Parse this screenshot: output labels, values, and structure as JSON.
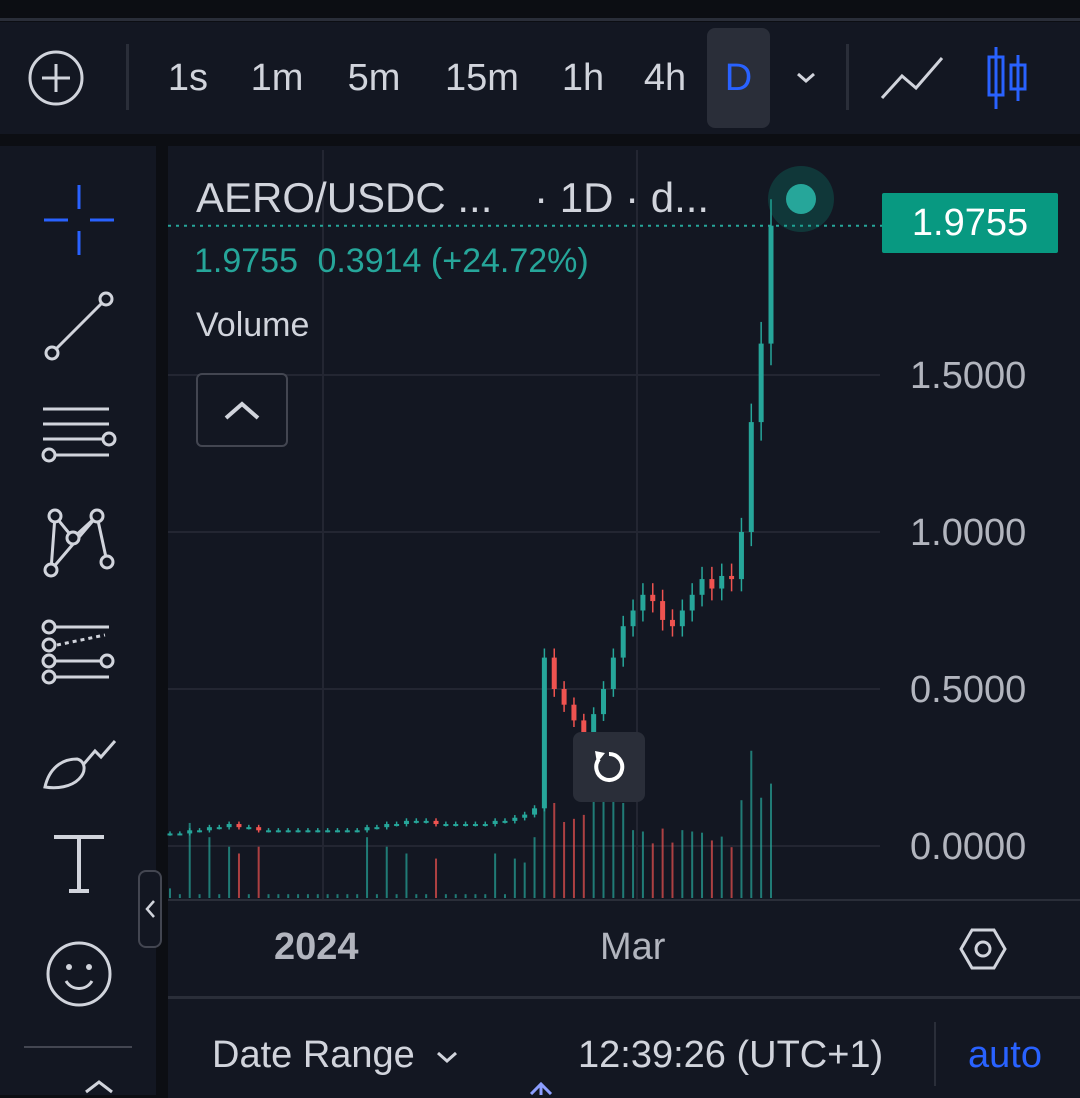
{
  "toolbar": {
    "intervals": [
      "1s",
      "1m",
      "5m",
      "15m",
      "1h",
      "4h",
      "D"
    ],
    "active_interval": "D"
  },
  "legend": {
    "title": "AERO/USDC ...",
    "timeframe": "· 1D · d...",
    "last": "1.9755",
    "change": "0.3914 (+24.72%)",
    "volume_label": "Volume"
  },
  "price_badge": "1.9755",
  "footer": {
    "date_range": "Date Range",
    "clock": "12:39:26 (UTC+1)",
    "auto": "auto"
  },
  "colors": {
    "up": "#26a69a",
    "down": "#ef5350",
    "badge": "#089981",
    "active_interval": "#2962ff"
  },
  "chart_data": {
    "type": "candlestick",
    "symbol": "AERO/USDC",
    "interval": "1D",
    "y_ticks": [
      "0.0000",
      "0.5000",
      "1.0000",
      "1.5000"
    ],
    "x_ticks": [
      "2024",
      "Mar"
    ],
    "ylim": [
      -0.15,
      2.2
    ],
    "last_price": 1.9755,
    "change": 0.3914,
    "change_pct": 24.72,
    "close_series_approx": [
      0.04,
      0.04,
      0.05,
      0.05,
      0.06,
      0.06,
      0.07,
      0.06,
      0.06,
      0.05,
      0.05,
      0.05,
      0.05,
      0.05,
      0.05,
      0.05,
      0.05,
      0.05,
      0.05,
      0.05,
      0.06,
      0.06,
      0.07,
      0.07,
      0.08,
      0.08,
      0.08,
      0.07,
      0.07,
      0.07,
      0.07,
      0.07,
      0.07,
      0.08,
      0.08,
      0.09,
      0.1,
      0.12,
      0.6,
      0.5,
      0.45,
      0.4,
      0.35,
      0.42,
      0.5,
      0.6,
      0.7,
      0.75,
      0.8,
      0.78,
      0.72,
      0.7,
      0.75,
      0.8,
      0.85,
      0.82,
      0.86,
      0.85,
      1.0,
      1.35,
      1.6,
      1.9755
    ]
  }
}
